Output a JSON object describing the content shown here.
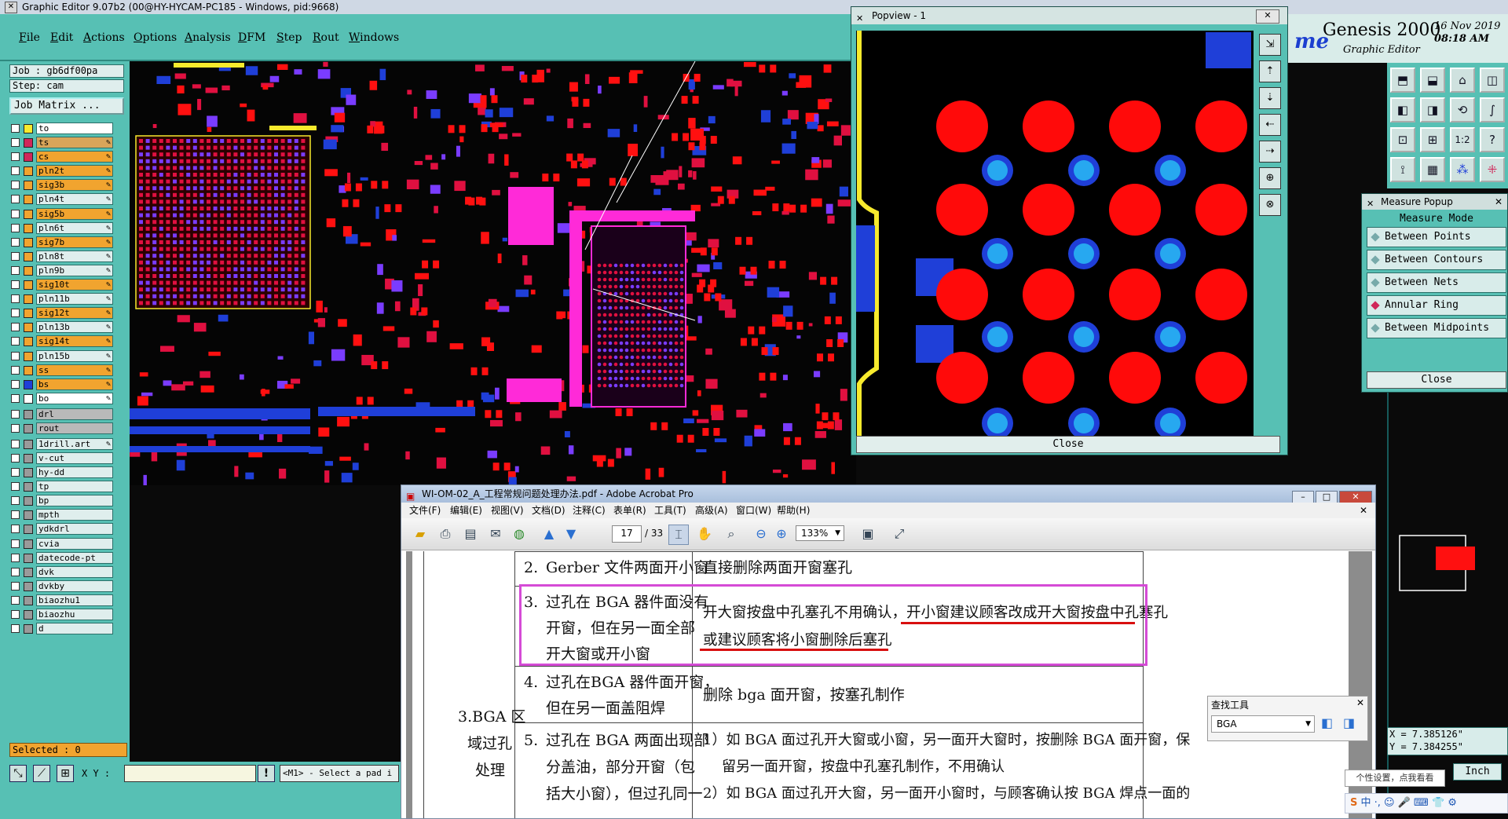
{
  "window": {
    "title": "Graphic Editor 9.07b2 (00@HY-HYCAM-PC185 - Windows, pid:9668)"
  },
  "menu": [
    "File",
    "Edit",
    "Actions",
    "Options",
    "Analysis",
    "DFM",
    "Step",
    "Rout",
    "Windows"
  ],
  "job": {
    "job_line": "Job : gb6df00pa",
    "step_line": "Step: cam",
    "matrix_button": "Job Matrix ..."
  },
  "layers": [
    {
      "name": "to",
      "color": "#f7ea2d",
      "bg": "#ffffff",
      "p": false
    },
    {
      "name": "ts",
      "color": "#d0275a",
      "bg": "#d9a55a",
      "p": true
    },
    {
      "name": "cs",
      "color": "#d0275a",
      "bg": "#f1a42f",
      "p": true
    },
    {
      "name": "pln2t",
      "color": "#f1a42f",
      "bg": "#f1a42f",
      "p": true
    },
    {
      "name": "sig3b",
      "color": "#f1a42f",
      "bg": "#f1a42f",
      "p": true
    },
    {
      "name": "pln4t",
      "color": "#f1a42f",
      "bg": "#dfeeed",
      "p": true
    },
    {
      "name": "sig5b",
      "color": "#f1a42f",
      "bg": "#f1a42f",
      "p": true
    },
    {
      "name": "pln6t",
      "color": "#f1a42f",
      "bg": "#dfeeed",
      "p": true
    },
    {
      "name": "sig7b",
      "color": "#f1a42f",
      "bg": "#f1a42f",
      "p": true
    },
    {
      "name": "pln8t",
      "color": "#f1a42f",
      "bg": "#dfeeed",
      "p": true
    },
    {
      "name": "pln9b",
      "color": "#f1a42f",
      "bg": "#dfeeed",
      "p": true
    },
    {
      "name": "sig10t",
      "color": "#f1a42f",
      "bg": "#f1a42f",
      "p": true
    },
    {
      "name": "pln11b",
      "color": "#f1a42f",
      "bg": "#dfeeed",
      "p": true
    },
    {
      "name": "sig12t",
      "color": "#f1a42f",
      "bg": "#f1a42f",
      "p": true
    },
    {
      "name": "pln13b",
      "color": "#f1a42f",
      "bg": "#dfeeed",
      "p": true
    },
    {
      "name": "sig14t",
      "color": "#f1a42f",
      "bg": "#f1a42f",
      "p": true
    },
    {
      "name": "pln15b",
      "color": "#f1a42f",
      "bg": "#dfeeed",
      "p": true
    },
    {
      "name": "ss",
      "color": "#f1a42f",
      "bg": "#f1a42f",
      "p": true
    },
    {
      "name": "bs",
      "color": "#1f3fd8",
      "bg": "#f1a42f",
      "p": true
    },
    {
      "name": "bo",
      "color": "#ffffff",
      "bg": "#ffffff",
      "p": true
    },
    {
      "name": "drl",
      "color": "#9a9a9a",
      "bg": "#b9b9b9",
      "p": false
    },
    {
      "name": "rout",
      "color": "#9a9a9a",
      "bg": "#b9b9b9",
      "p": false
    },
    {
      "name": "1drill.art",
      "color": "#9a9a9a",
      "bg": "#dfeeed",
      "p": true
    },
    {
      "name": "v-cut",
      "color": "#9a9a9a",
      "bg": "#dfeeed",
      "p": false
    },
    {
      "name": "hy-dd",
      "color": "#9a9a9a",
      "bg": "#dfeeed",
      "p": false
    },
    {
      "name": "tp",
      "color": "#9a9a9a",
      "bg": "#dfeeed",
      "p": false
    },
    {
      "name": "bp",
      "color": "#9a9a9a",
      "bg": "#dfeeed",
      "p": false
    },
    {
      "name": "mpth",
      "color": "#9a9a9a",
      "bg": "#dfeeed",
      "p": false
    },
    {
      "name": "ydkdrl",
      "color": "#9a9a9a",
      "bg": "#dfeeed",
      "p": false
    },
    {
      "name": "cvia",
      "color": "#9a9a9a",
      "bg": "#dfeeed",
      "p": false
    },
    {
      "name": "datecode-pt",
      "color": "#9a9a9a",
      "bg": "#dfeeed",
      "p": false
    },
    {
      "name": "dvk",
      "color": "#9a9a9a",
      "bg": "#dfeeed",
      "p": false
    },
    {
      "name": "dvkby",
      "color": "#9a9a9a",
      "bg": "#dfeeed",
      "p": false
    },
    {
      "name": "biaozhu1",
      "color": "#9a9a9a",
      "bg": "#dfeeed",
      "p": false
    },
    {
      "name": "biaozhu",
      "color": "#9a9a9a",
      "bg": "#dfeeed",
      "p": false
    },
    {
      "name": "d",
      "color": "#9a9a9a",
      "bg": "#dfeeed",
      "p": false
    }
  ],
  "status": {
    "selected": "Selected : 0",
    "xy_label": "X Y :",
    "xy_value": "",
    "message": "<M1> - Select a pad i"
  },
  "popview": {
    "title": "Popview - 1",
    "close_label": "Close"
  },
  "genesis": {
    "brand": "Genesis 2000",
    "subtitle": "Graphic Editor",
    "date": "16 Nov 2019",
    "time": "08:18 AM",
    "logo_part": "me"
  },
  "measure": {
    "title": "Measure Popup",
    "header": "Measure Mode",
    "modes": [
      "Between Points",
      "Between Contours",
      "Between Nets",
      "Annular Ring",
      "Between Midpoints"
    ],
    "selected_mode": "Annular Ring",
    "close_label": "Close"
  },
  "acrobat": {
    "title": "WI-OM-02_A_工程常规问题处理办法.pdf - Adobe Acrobat Pro",
    "menu": [
      "文件(F)",
      "编辑(E)",
      "视图(V)",
      "文档(D)",
      "注释(C)",
      "表单(R)",
      "工具(T)",
      "高级(A)",
      "窗口(W)",
      "帮助(H)"
    ],
    "page_current": "17",
    "page_total": "/ 33",
    "zoom": "133%",
    "doc": {
      "row2_num": "2.",
      "row2_left": "Gerber 文件两面开小窗",
      "row2_right": "直接删除两面开窗塞孔",
      "row3_num": "3.",
      "row3_left": [
        "过孔在 BGA 器件面没有",
        "开窗，但在另一面全部",
        "开大窗或开小窗"
      ],
      "row3_right": [
        "开大窗按盘中孔塞孔不用确认，开小窗建议顾客改成开大窗按盘中孔塞孔",
        "或建议顾客将小窗删除后塞孔"
      ],
      "row4_num": "4.",
      "row4_left": [
        "过孔在BGA 器件面开窗，",
        "但在另一面盖阻焊"
      ],
      "row4_right": "删除 bga 面开窗，按塞孔制作",
      "section": [
        "3.BGA 区",
        "域过孔",
        "处理"
      ],
      "row5_num": "5.",
      "row5_left": [
        "过孔在 BGA 两面出现部",
        "分盖油，部分开窗（包",
        "括大小窗），但过孔同一"
      ],
      "row5_right": [
        "1）如 BGA 面过孔开大窗或小窗，另一面开大窗时，按删除 BGA 面开窗，保",
        "留另一面开窗，按盘中孔塞孔制作，不用确认",
        "2）如 BGA 面过孔开大窗，另一面开小窗时，与顾客确认按 BGA 焊点一面的"
      ]
    }
  },
  "findtool": {
    "title": "查找工具",
    "value": "BGA"
  },
  "readout": {
    "x": "X = 7.385126\"",
    "y": "Y = 7.384255\"",
    "unit_button": "Inch"
  },
  "tooltip": "个性设置，点我看看",
  "ime": "中 ·, ☺ 🎤 ⌨ 👕 ⚙"
}
